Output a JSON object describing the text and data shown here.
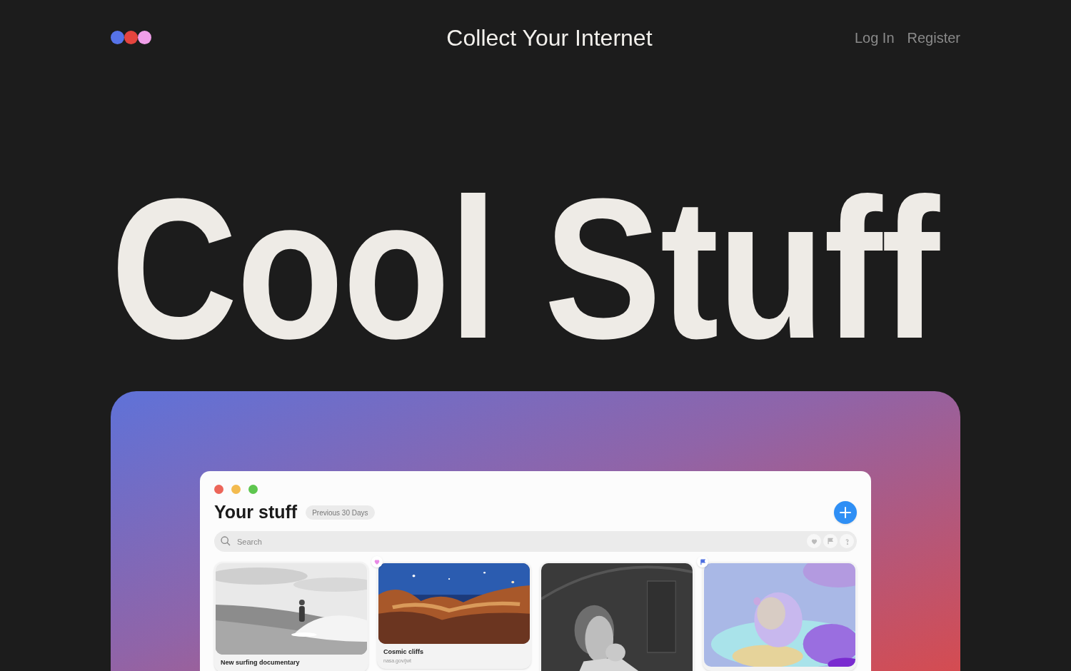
{
  "header": {
    "title": "Collect Your Internet",
    "links": [
      "Log In",
      "Register"
    ]
  },
  "hero": {
    "heading": "Cool Stuff"
  },
  "app_window": {
    "title": "Your stuff",
    "filter": "Previous 30 Days",
    "search": {
      "placeholder": "Search"
    },
    "cards": [
      {
        "title": "New surfing documentary",
        "liked": false,
        "flagged": false
      },
      {
        "title": "Cosmic cliffs",
        "source": "nasa.gov/jwt",
        "liked": true,
        "flagged": false
      },
      {
        "liked": false,
        "flagged": false
      },
      {
        "liked": false,
        "flagged": true
      }
    ]
  }
}
